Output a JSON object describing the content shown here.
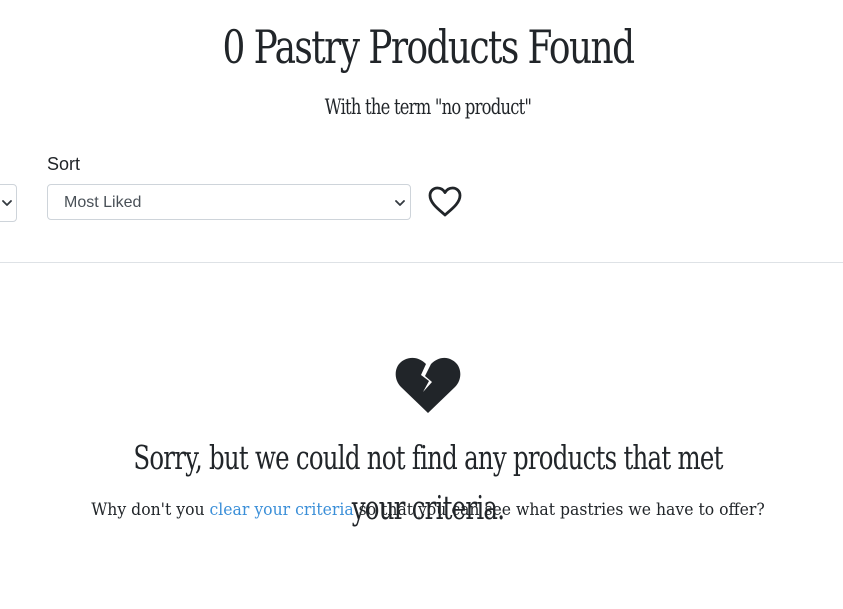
{
  "header": {
    "title": "0 Pastry Products Found",
    "subtitle": "With the term \"no product\""
  },
  "filters": {
    "sort": {
      "label": "Sort",
      "selected": "Most Liked"
    },
    "favorite_icon": "heart-outline-icon",
    "dropdown_icon": "chevron-down-icon"
  },
  "empty_state": {
    "icon": "broken-heart-icon",
    "heading": "Sorry, but we could not find any products that met your criteria.",
    "message_before": "Why don't you ",
    "link_text": "clear your criteria",
    "message_after": " so that you can see what pastries we have to offer?"
  },
  "colors": {
    "text": "#212529",
    "link": "#3b8fd8",
    "border": "#ced4da",
    "divider": "#dee2e6"
  }
}
